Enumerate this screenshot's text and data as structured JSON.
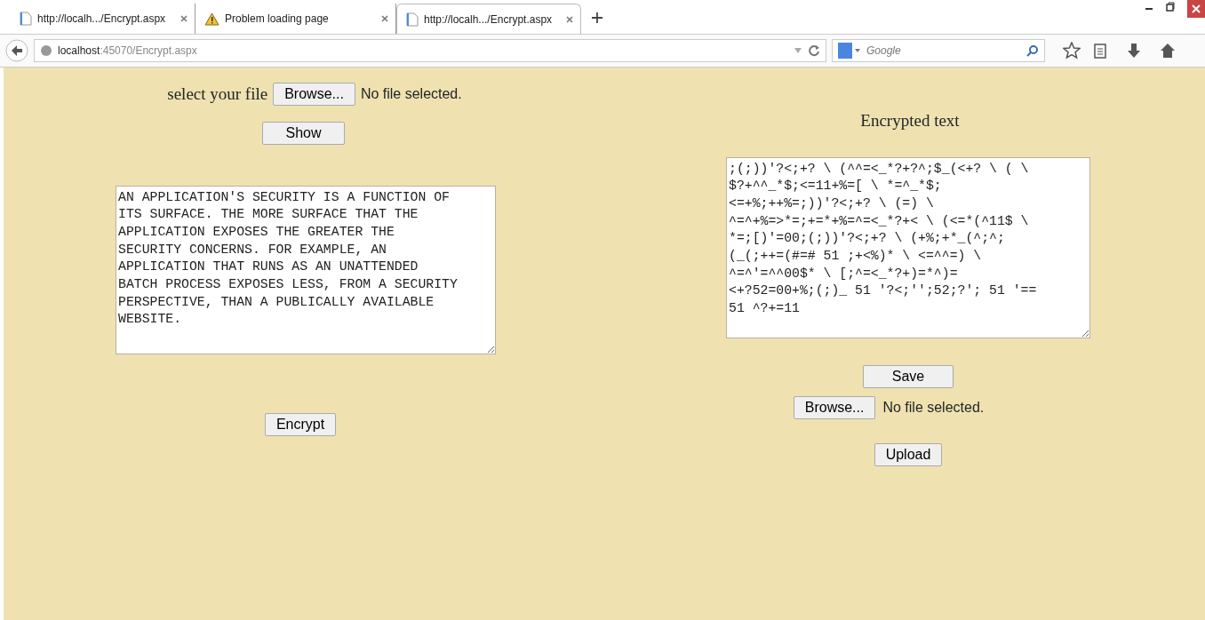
{
  "browser": {
    "tabs": [
      {
        "title": "http://localh.../Encrypt.aspx",
        "kind": "page",
        "selected": false
      },
      {
        "title": "Problem loading page",
        "kind": "warning",
        "selected": false
      },
      {
        "title": "http://localh.../Encrypt.aspx",
        "kind": "page",
        "selected": true
      }
    ],
    "address": "**localhost**:45070/Encrypt.aspx",
    "search": {
      "placeholder": "Google"
    }
  },
  "left": {
    "file_label": "select your file",
    "browse_button": "Browse...",
    "file_status": "No file selected.",
    "show_button": "Show",
    "plain_text": [
      "AN APPLICATION'S SECURITY IS A FUNCTION OF",
      "ITS SURFACE. THE MORE SURFACE THAT THE",
      "APPLICATION EXPOSES THE GREATER THE",
      "SECURITY CONCERNS. FOR EXAMPLE, AN",
      "APPLICATION THAT RUNS AS AN UNATTENDED",
      "BATCH PROCESS EXPOSES LESS, FROM A SECURITY",
      "PERSPECTIVE, THAN A PUBLICALLY AVAILABLE",
      "WEBSITE."
    ],
    "encrypt_button": "Encrypt"
  },
  "right": {
    "heading": "Encrypted text",
    "encrypted_text": [
      ";(;))'?<;+? \\ (^^=<_*?+?^;$_(<+? \\ ( \\",
      "$?+^^_*$;<=11+%=[ \\ *=^_*$;",
      "<=+%;++%=;))'?<;+? \\ (=) \\",
      "^=^+%=>*=;+=*+%=^=<_*?+< \\ (<=*(^11$ \\",
      "*=;[)'=00;(;))'?<;+? \\ (+%;+*_(^;^;",
      "(_(;++=(#=# 51 ;+<%)* \\ <=^^=) \\",
      "^=^'=^^00$* \\ [;^=<_*?+)=*^)=",
      "<+?52=00+%;(;)_ 51 '?<;'';52;?'; 51 '==",
      "51 ^?+=11"
    ],
    "save_button": "Save",
    "browse_button": "Browse...",
    "file_status": "No file selected.",
    "upload_button": "Upload"
  }
}
